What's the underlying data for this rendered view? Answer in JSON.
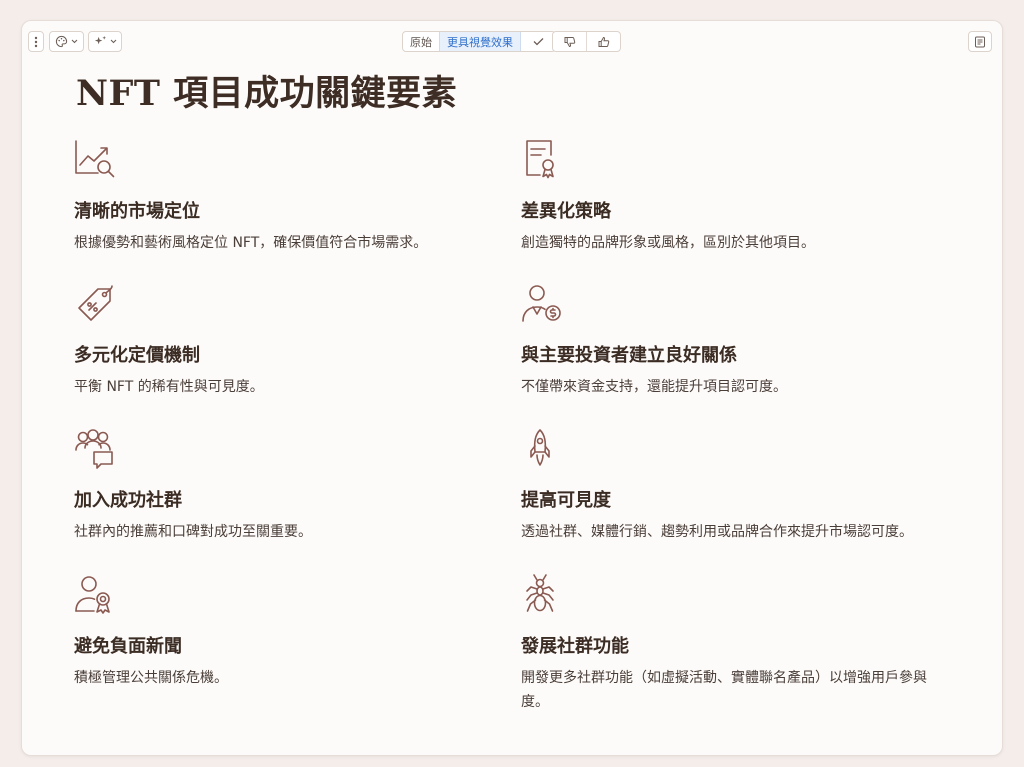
{
  "toolbar": {
    "style_options": [
      "原始",
      "更具視覺效果"
    ],
    "active_style": "更具視覺效果"
  },
  "page": {
    "title": "NFT 項目成功關鍵要素"
  },
  "items": [
    {
      "icon": "chart-search-icon",
      "title": "清晰的市場定位",
      "desc": "根據優勢和藝術風格定位 NFT，確保價值符合市場需求。"
    },
    {
      "icon": "certificate-icon",
      "title": "差異化策略",
      "desc": "創造獨特的品牌形象或風格，區別於其他項目。"
    },
    {
      "icon": "price-tag-icon",
      "title": "多元化定價機制",
      "desc": "平衡 NFT 的稀有性與可見度。"
    },
    {
      "icon": "investor-icon",
      "title": "與主要投資者建立良好關係",
      "desc": "不僅帶來資金支持，還能提升項目認可度。"
    },
    {
      "icon": "community-icon",
      "title": "加入成功社群",
      "desc": "社群內的推薦和口碑對成功至關重要。"
    },
    {
      "icon": "rocket-icon",
      "title": "提高可見度",
      "desc": "透過社群、媒體行銷、趨勢利用或品牌合作來提升市場認可度。"
    },
    {
      "icon": "award-person-icon",
      "title": "避免負面新聞",
      "desc": "積極管理公共關係危機。"
    },
    {
      "icon": "ant-icon",
      "title": "發展社群功能",
      "desc": "開發更多社群功能（如虛擬活動、實體聯名產品）以增強用戶參與度。"
    }
  ]
}
